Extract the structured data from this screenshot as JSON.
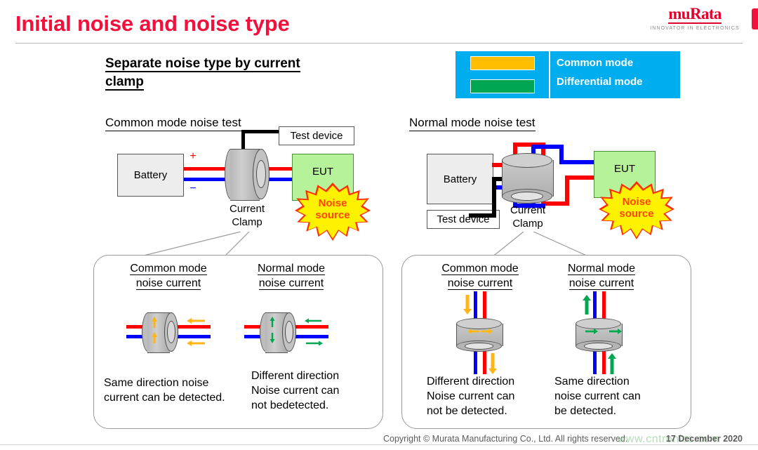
{
  "header": {
    "title": "Initial noise and noise type",
    "logo": {
      "mark": "muRata",
      "tagline": "INNOVATOR IN ELECTRONICS"
    }
  },
  "subtitle": {
    "line1": "Separate noise type by current",
    "line2": "clamp"
  },
  "legend": {
    "rows": [
      {
        "label": "Common mode",
        "color": "#FFBE00"
      },
      {
        "label": "Differential mode",
        "color": "#00A651"
      }
    ],
    "background": "#00AEEF"
  },
  "panels": {
    "left": {
      "heading": "Common mode noise test",
      "battery": "Battery",
      "plus": "+",
      "minus": "−",
      "test_device": "Test device",
      "eut": "EUT",
      "noise_source_l1": "Noise",
      "noise_source_l2": "source",
      "clamp_l1": "Current",
      "clamp_l2": "Clamp"
    },
    "right": {
      "heading": "Normal mode noise test",
      "battery": "Battery",
      "test_device": "Test device",
      "eut": "EUT",
      "noise_source_l1": "Noise",
      "noise_source_l2": "source",
      "clamp_l1": "Current",
      "clamp_l2": "Clamp"
    }
  },
  "callouts": {
    "left": {
      "col1": {
        "head_l1": "Common mode ",
        "head_l2": "noise current",
        "text_l1": "Same direction noise",
        "text_l2": "current can be detected.",
        "arrow_color": "#FFB515"
      },
      "col2": {
        "head_l1": "Normal mode ",
        "head_l2": "noise current ",
        "text_l1": "Different direction",
        "text_l2": "Noise current can",
        "text_l3": "not bedetected.",
        "arrow_color": "#00A651"
      }
    },
    "right": {
      "col1": {
        "head_l1": "Common mode ",
        "head_l2": "noise current",
        "text_l1": "Different direction",
        "text_l2": "Noise current can",
        "text_l3": "not be detected.",
        "arrow_color": "#FFB515"
      },
      "col2": {
        "head_l1": "Normal mode ",
        "head_l2": "noise current ",
        "text_l1": "Same direction",
        "text_l2": "noise current can",
        "text_l3": "be detected.",
        "arrow_color": "#00A651"
      }
    }
  },
  "footer": {
    "copyright": "Copyright © Murata Manufacturing Co., Ltd. All rights reserved.",
    "date": "17 December 2020",
    "watermark": "www.cntronics.com"
  },
  "colors": {
    "title_red": "#F2113C",
    "wire_positive": "#FF0000",
    "wire_negative": "#0000FF",
    "wire_ground": "#000000",
    "eut_green": "#B6F29A",
    "burst_yellow": "#FFF200"
  }
}
